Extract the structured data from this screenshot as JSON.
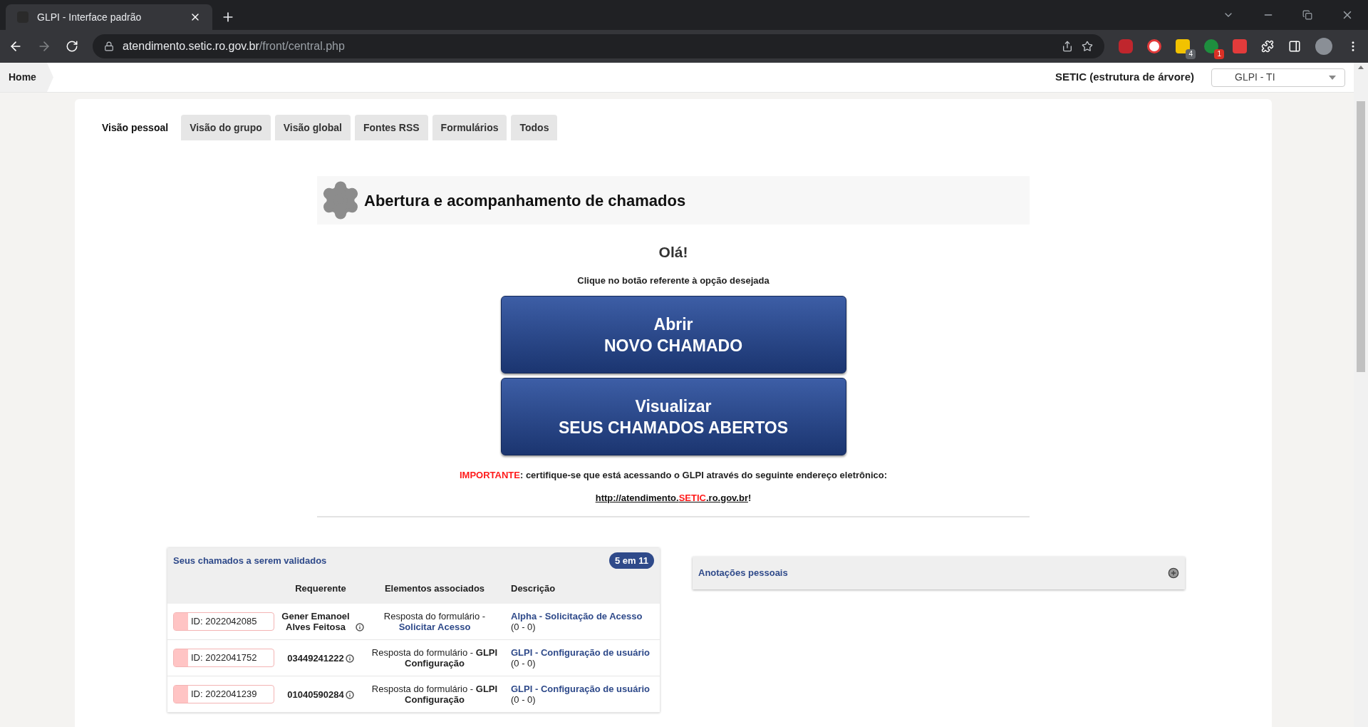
{
  "browser": {
    "tab_title": "GLPI - Interface padrão",
    "url_host": "atendimento.setic.ro.gov.br",
    "url_path": "/front/central.php",
    "badges": [
      "4",
      "1"
    ]
  },
  "breadcrumb": "Home",
  "entity": {
    "label": "SETIC (estrutura de árvore)",
    "select": "GLPI - TI"
  },
  "tabs": [
    {
      "label": "Visão pessoal",
      "selected": true
    },
    {
      "label": "Visão do grupo",
      "selected": false
    },
    {
      "label": "Visão global",
      "selected": false
    },
    {
      "label": "Fontes RSS",
      "selected": false
    },
    {
      "label": "Formulários",
      "selected": false
    },
    {
      "label": "Todos",
      "selected": false
    }
  ],
  "panel": {
    "title": "Abertura e acompanhamento de chamados",
    "greeting": "Olá!",
    "instruction": "Clique no botão referente à opção desejada",
    "buttons": [
      {
        "lines": [
          "Abrir",
          "NOVO CHAMADO"
        ]
      },
      {
        "lines": [
          "Visualizar",
          "SEUS CHAMADOS ABERTOS"
        ]
      }
    ],
    "warning": {
      "label": "IMPORTANTE",
      "text": ": certifique-se que está acessando o GLPI através do seguinte endereço eletrônico:"
    },
    "address": {
      "before": "http://atendimento.",
      "highlight": "SETIC",
      "after": ".ro.gov.br",
      "suffix": "!"
    }
  },
  "validation_table": {
    "title": "Seus chamados a serem validados",
    "count": "5 em 11",
    "columns": [
      "Requerente",
      "Elementos associados",
      "Descrição"
    ],
    "rows": [
      {
        "id": "ID: 2022042085",
        "requester": "Gener Emanoel Alves Feitosa",
        "elements": {
          "text": "Resposta do formulário -",
          "link": "Solicitar Acesso"
        },
        "description": "Alpha - Solicitação de Acesso",
        "counts": "(0 - 0)"
      },
      {
        "id": "ID: 2022041752",
        "requester": "03449241222",
        "elements": {
          "text": "Resposta do formulário - **GLPI Configuração**"
        },
        "description": "GLPI - Configuração de usuário",
        "counts": "(0 - 0)"
      },
      {
        "id": "ID: 2022041239",
        "requester": "01040590284",
        "elements": {
          "text": "Resposta do formulário - **GLPI Configuração**"
        },
        "description": "GLPI - Configuração de usuário",
        "counts": "(0 - 0)"
      }
    ]
  },
  "notes": {
    "title": "Anotações pessoais"
  }
}
